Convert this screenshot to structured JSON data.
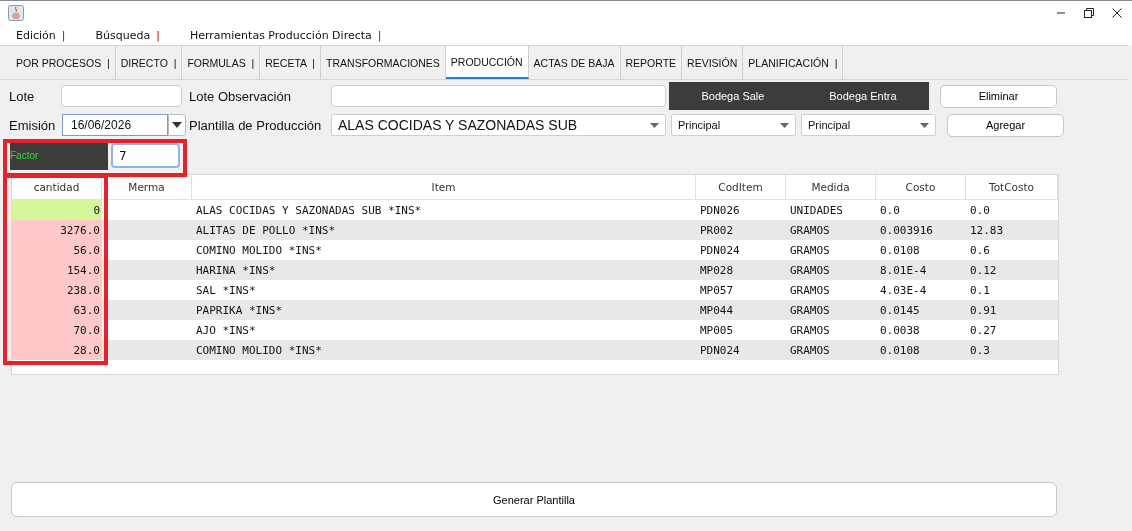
{
  "menu": [
    {
      "label": "Edición",
      "separator": "|"
    },
    {
      "label": "Búsqueda",
      "separator": "|"
    },
    {
      "label": "Herramientas Producción Directa",
      "separator": "|"
    }
  ],
  "tabs": [
    {
      "label": "POR PROCESOS  |",
      "selected": false
    },
    {
      "label": "DIRECTO  |",
      "selected": false
    },
    {
      "label": "FORMULAS  |",
      "selected": false
    },
    {
      "label": "RECETA  |",
      "selected": false
    },
    {
      "label": "TRANSFORMACIONES",
      "selected": false
    },
    {
      "label": "PRODUCCIÓN",
      "selected": true
    },
    {
      "label": "ACTAS DE BAJA",
      "selected": false
    },
    {
      "label": "REPORTE",
      "selected": false
    },
    {
      "label": "REVISIÓN",
      "selected": false
    },
    {
      "label": "PLANIFICACIÓN  |",
      "selected": false
    }
  ],
  "form": {
    "lote_label": "Lote",
    "lote_observacion_label": "Lote Observación",
    "bodega_sale": "Bodega Sale",
    "bodega_entra": "Bodega Entra",
    "eliminar": "Eliminar",
    "emision_label": "Emisión",
    "emision": "16/06/2026",
    "plantilla_label": "Plantilla de Producción",
    "plantilla": "ALAS COCIDAS Y SAZONADAS SUB",
    "bodega_sale_value": "Principal",
    "bodega_entra_value": "Principal",
    "agregar": "Agregar",
    "factor_label": "Factor",
    "factor": "7"
  },
  "table": {
    "columns": [
      "cantidad",
      "Merma",
      "Item",
      "CodItem",
      "Medida",
      "Costo",
      "TotCosto"
    ],
    "rows": [
      {
        "cantidad": "0",
        "color": "#d6f59a",
        "item": "ALAS COCIDAS Y SAZONADAS SUB *INS*",
        "coditem": "PDN026",
        "medida": "UNIDADES",
        "costo": "0.0",
        "totcosto": "0.0"
      },
      {
        "cantidad": "3276.0",
        "color": "#ffc8c8",
        "item": "ALITAS DE POLLO *INS*",
        "coditem": "PR002",
        "medida": "GRAMOS",
        "costo": "0.003916",
        "totcosto": "12.83"
      },
      {
        "cantidad": "56.0",
        "color": "#ffc8c8",
        "item": "COMINO MOLIDO *INS*",
        "coditem": "PDN024",
        "medida": "GRAMOS",
        "costo": "0.0108",
        "totcosto": "0.6"
      },
      {
        "cantidad": "154.0",
        "color": "#ffc8c8",
        "item": "HARINA *INS*",
        "coditem": "MP028",
        "medida": "GRAMOS",
        "costo": "8.01E-4",
        "totcosto": "0.12"
      },
      {
        "cantidad": "238.0",
        "color": "#ffc8c8",
        "item": "SAL *INS*",
        "coditem": "MP057",
        "medida": "GRAMOS",
        "costo": "4.03E-4",
        "totcosto": "0.1"
      },
      {
        "cantidad": "63.0",
        "color": "#ffc8c8",
        "item": "PAPRIKA *INS*",
        "coditem": "MP044",
        "medida": "GRAMOS",
        "costo": "0.0145",
        "totcosto": "0.91"
      },
      {
        "cantidad": "70.0",
        "color": "#ffc8c8",
        "item": "AJO *INS*",
        "coditem": "MP005",
        "medida": "GRAMOS",
        "costo": "0.0038",
        "totcosto": "0.27"
      },
      {
        "cantidad": "28.0",
        "color": "#ffc8c8",
        "item": "COMINO MOLIDO *INS*",
        "coditem": "PDN024",
        "medida": "GRAMOS",
        "costo": "0.0108",
        "totcosto": "0.3"
      }
    ]
  },
  "generar": "Generar Plantilla"
}
